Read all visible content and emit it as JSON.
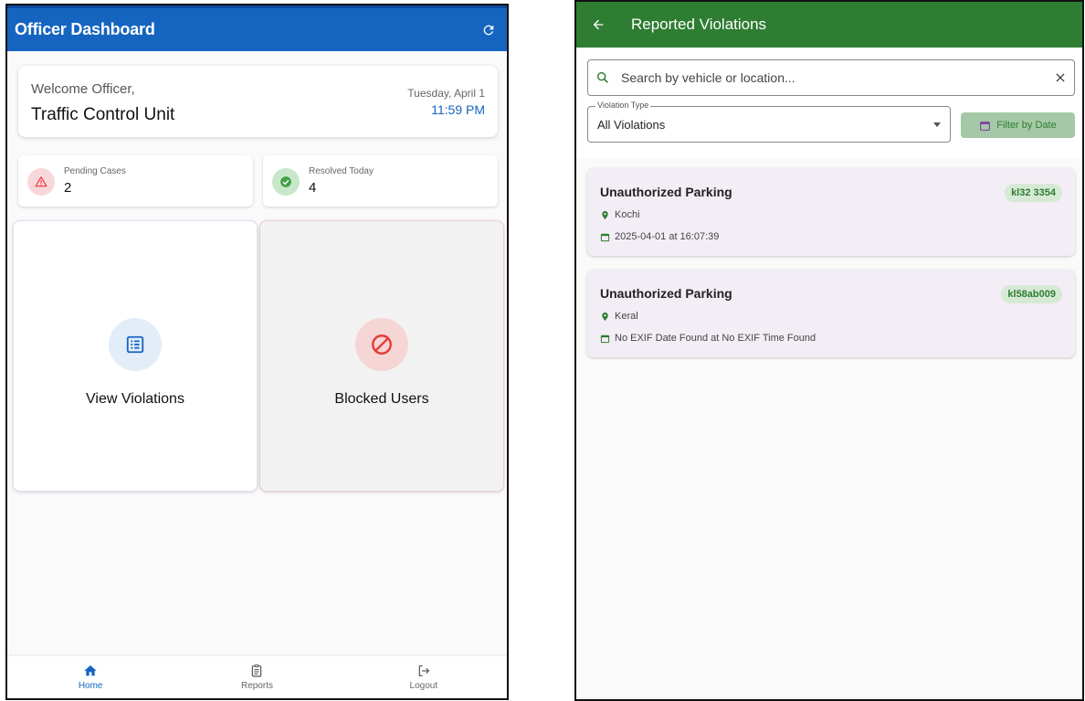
{
  "dashboard": {
    "title": "Officer Dashboard",
    "welcome": "Welcome Officer,",
    "unit": "Traffic Control Unit",
    "date": "Tuesday, April 1",
    "time": "11:59 PM",
    "stats": {
      "pending_label": "Pending Cases",
      "pending_value": "2",
      "resolved_label": "Resolved Today",
      "resolved_value": "4"
    },
    "tiles": {
      "violations_label": "View Violations",
      "blocked_label": "Blocked Users"
    },
    "nav": {
      "home": "Home",
      "reports": "Reports",
      "logout": "Logout"
    },
    "icons": {
      "refresh": "refresh-icon",
      "pending": "warning-icon",
      "resolved": "check-circle-icon",
      "violations": "list-icon",
      "blocked": "block-icon",
      "home": "home-icon",
      "reports": "clipboard-icon",
      "logout": "logout-icon"
    },
    "colors": {
      "appbar": "#1565c0",
      "pending": "#e53935",
      "resolved": "#43a047"
    }
  },
  "violations": {
    "title": "Reported Violations",
    "search_placeholder": "Search by vehicle or location...",
    "type_legend": "Violation Type",
    "type_value": "All Violations",
    "date_filter_label": "Filter by Date",
    "items": [
      {
        "type": "Unauthorized Parking",
        "plate": "kl32 3354",
        "location": "Kochi",
        "datetime": "2025-04-01 at 16:07:39"
      },
      {
        "type": "Unauthorized Parking",
        "plate": "kl58ab009",
        "location": "Keral",
        "datetime": "No EXIF Date Found at No EXIF Time Found"
      }
    ],
    "icons": {
      "back": "arrow-back-icon",
      "search": "search-icon",
      "clear": "close-icon",
      "calendar": "calendar-icon",
      "location": "location-pin-icon"
    },
    "colors": {
      "appbar": "#2e7d32",
      "plate_bg": "#d6e9d5"
    }
  }
}
